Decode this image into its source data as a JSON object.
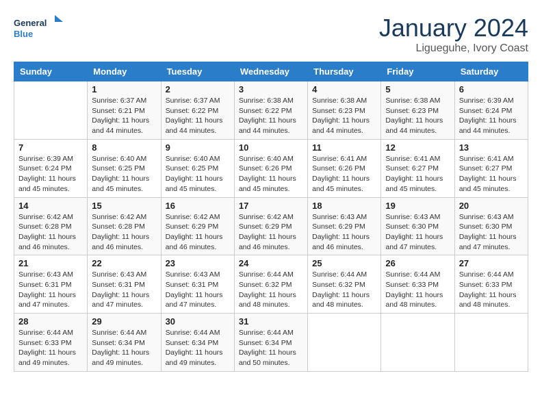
{
  "header": {
    "logo_line1": "General",
    "logo_line2": "Blue",
    "month": "January 2024",
    "location": "Ligueguhe, Ivory Coast"
  },
  "weekdays": [
    "Sunday",
    "Monday",
    "Tuesday",
    "Wednesday",
    "Thursday",
    "Friday",
    "Saturday"
  ],
  "weeks": [
    [
      {
        "day": "",
        "info": ""
      },
      {
        "day": "1",
        "info": "Sunrise: 6:37 AM\nSunset: 6:21 PM\nDaylight: 11 hours\nand 44 minutes."
      },
      {
        "day": "2",
        "info": "Sunrise: 6:37 AM\nSunset: 6:22 PM\nDaylight: 11 hours\nand 44 minutes."
      },
      {
        "day": "3",
        "info": "Sunrise: 6:38 AM\nSunset: 6:22 PM\nDaylight: 11 hours\nand 44 minutes."
      },
      {
        "day": "4",
        "info": "Sunrise: 6:38 AM\nSunset: 6:23 PM\nDaylight: 11 hours\nand 44 minutes."
      },
      {
        "day": "5",
        "info": "Sunrise: 6:38 AM\nSunset: 6:23 PM\nDaylight: 11 hours\nand 44 minutes."
      },
      {
        "day": "6",
        "info": "Sunrise: 6:39 AM\nSunset: 6:24 PM\nDaylight: 11 hours\nand 44 minutes."
      }
    ],
    [
      {
        "day": "7",
        "info": "Sunrise: 6:39 AM\nSunset: 6:24 PM\nDaylight: 11 hours\nand 45 minutes."
      },
      {
        "day": "8",
        "info": "Sunrise: 6:40 AM\nSunset: 6:25 PM\nDaylight: 11 hours\nand 45 minutes."
      },
      {
        "day": "9",
        "info": "Sunrise: 6:40 AM\nSunset: 6:25 PM\nDaylight: 11 hours\nand 45 minutes."
      },
      {
        "day": "10",
        "info": "Sunrise: 6:40 AM\nSunset: 6:26 PM\nDaylight: 11 hours\nand 45 minutes."
      },
      {
        "day": "11",
        "info": "Sunrise: 6:41 AM\nSunset: 6:26 PM\nDaylight: 11 hours\nand 45 minutes."
      },
      {
        "day": "12",
        "info": "Sunrise: 6:41 AM\nSunset: 6:27 PM\nDaylight: 11 hours\nand 45 minutes."
      },
      {
        "day": "13",
        "info": "Sunrise: 6:41 AM\nSunset: 6:27 PM\nDaylight: 11 hours\nand 45 minutes."
      }
    ],
    [
      {
        "day": "14",
        "info": "Sunrise: 6:42 AM\nSunset: 6:28 PM\nDaylight: 11 hours\nand 46 minutes."
      },
      {
        "day": "15",
        "info": "Sunrise: 6:42 AM\nSunset: 6:28 PM\nDaylight: 11 hours\nand 46 minutes."
      },
      {
        "day": "16",
        "info": "Sunrise: 6:42 AM\nSunset: 6:29 PM\nDaylight: 11 hours\nand 46 minutes."
      },
      {
        "day": "17",
        "info": "Sunrise: 6:42 AM\nSunset: 6:29 PM\nDaylight: 11 hours\nand 46 minutes."
      },
      {
        "day": "18",
        "info": "Sunrise: 6:43 AM\nSunset: 6:29 PM\nDaylight: 11 hours\nand 46 minutes."
      },
      {
        "day": "19",
        "info": "Sunrise: 6:43 AM\nSunset: 6:30 PM\nDaylight: 11 hours\nand 47 minutes."
      },
      {
        "day": "20",
        "info": "Sunrise: 6:43 AM\nSunset: 6:30 PM\nDaylight: 11 hours\nand 47 minutes."
      }
    ],
    [
      {
        "day": "21",
        "info": "Sunrise: 6:43 AM\nSunset: 6:31 PM\nDaylight: 11 hours\nand 47 minutes."
      },
      {
        "day": "22",
        "info": "Sunrise: 6:43 AM\nSunset: 6:31 PM\nDaylight: 11 hours\nand 47 minutes."
      },
      {
        "day": "23",
        "info": "Sunrise: 6:43 AM\nSunset: 6:31 PM\nDaylight: 11 hours\nand 47 minutes."
      },
      {
        "day": "24",
        "info": "Sunrise: 6:44 AM\nSunset: 6:32 PM\nDaylight: 11 hours\nand 48 minutes."
      },
      {
        "day": "25",
        "info": "Sunrise: 6:44 AM\nSunset: 6:32 PM\nDaylight: 11 hours\nand 48 minutes."
      },
      {
        "day": "26",
        "info": "Sunrise: 6:44 AM\nSunset: 6:33 PM\nDaylight: 11 hours\nand 48 minutes."
      },
      {
        "day": "27",
        "info": "Sunrise: 6:44 AM\nSunset: 6:33 PM\nDaylight: 11 hours\nand 48 minutes."
      }
    ],
    [
      {
        "day": "28",
        "info": "Sunrise: 6:44 AM\nSunset: 6:33 PM\nDaylight: 11 hours\nand 49 minutes."
      },
      {
        "day": "29",
        "info": "Sunrise: 6:44 AM\nSunset: 6:34 PM\nDaylight: 11 hours\nand 49 minutes."
      },
      {
        "day": "30",
        "info": "Sunrise: 6:44 AM\nSunset: 6:34 PM\nDaylight: 11 hours\nand 49 minutes."
      },
      {
        "day": "31",
        "info": "Sunrise: 6:44 AM\nSunset: 6:34 PM\nDaylight: 11 hours\nand 50 minutes."
      },
      {
        "day": "",
        "info": ""
      },
      {
        "day": "",
        "info": ""
      },
      {
        "day": "",
        "info": ""
      }
    ]
  ]
}
